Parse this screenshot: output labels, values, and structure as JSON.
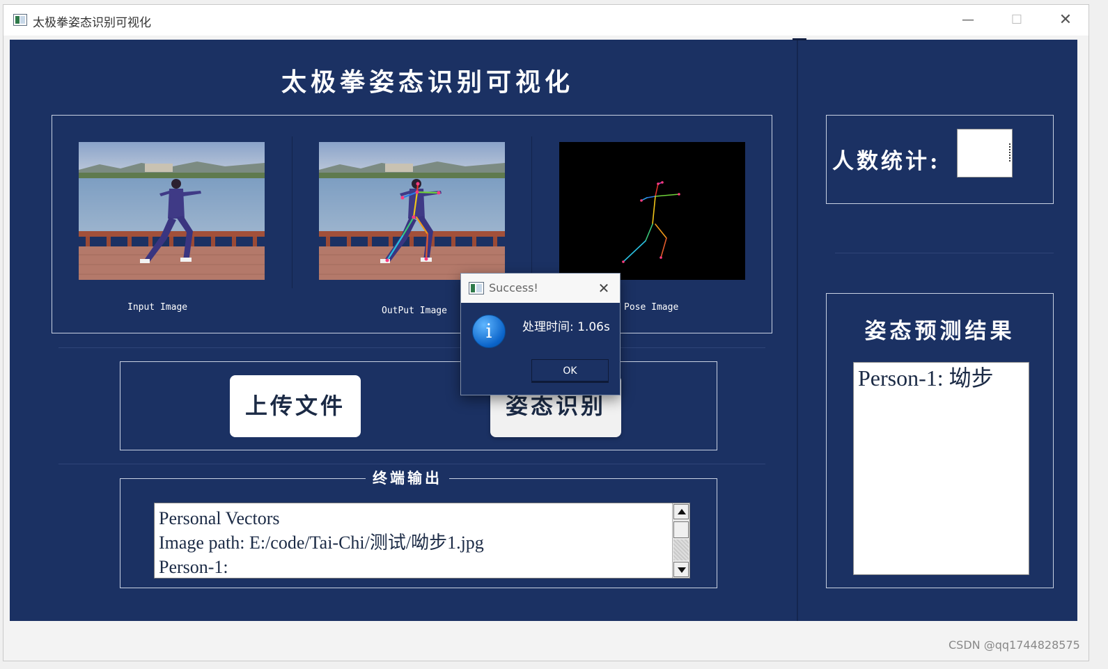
{
  "window": {
    "title": "太极拳姿态识别可视化",
    "minimize": "—",
    "maximize": "☐",
    "close": "✕"
  },
  "app": {
    "heading": "太极拳姿态识别可视化"
  },
  "images": {
    "input_caption": "Input Image",
    "output_caption": "OutPut Image",
    "pose_caption": "Pose Image"
  },
  "buttons": {
    "upload": "上传文件",
    "detect": "姿态识别"
  },
  "terminal": {
    "legend": "终端输出",
    "lines": [
      "Personal Vectors",
      "Image path: E:/code/Tai-Chi/测试/呦步1.jpg",
      "Person-1:"
    ]
  },
  "count": {
    "label": "人数统计:",
    "value": ""
  },
  "result": {
    "title": "姿态预测结果",
    "text": "Person-1: 坳步"
  },
  "dialog": {
    "title": "Success!",
    "close": "✕",
    "icon": "i",
    "message": "处理时间: 1.06s",
    "ok": "OK"
  },
  "watermark": "CSDN @qq1744828575"
}
